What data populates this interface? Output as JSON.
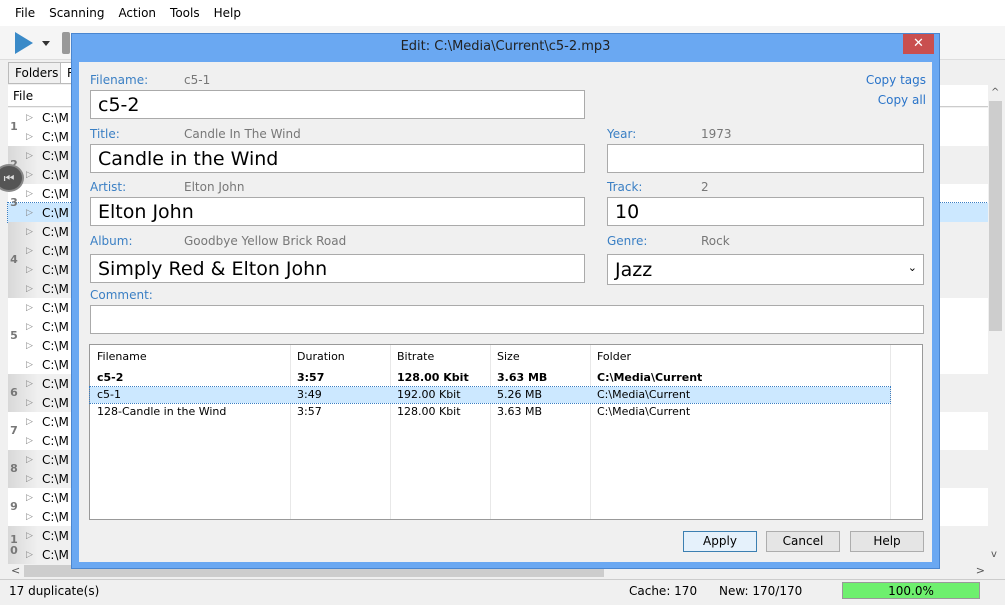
{
  "menu": [
    "File",
    "Scanning",
    "Action",
    "Tools",
    "Help"
  ],
  "tabs": [
    "Folders",
    "R"
  ],
  "list": {
    "header": "File",
    "row_text": "C:\\M",
    "groups": [
      {
        "n": "1",
        "rows": 2
      },
      {
        "n": "2",
        "rows": 2
      },
      {
        "n": "3",
        "rows": 2
      },
      {
        "n": "4",
        "rows": 4
      },
      {
        "n": "5",
        "rows": 4
      },
      {
        "n": "6",
        "rows": 2
      },
      {
        "n": "7",
        "rows": 2
      },
      {
        "n": "8",
        "rows": 2
      },
      {
        "n": "9",
        "rows": 2
      },
      {
        "n": "10",
        "rows": 2
      }
    ],
    "selected_row": 5
  },
  "status": {
    "duplicates": "17 duplicate(s)",
    "cache": "Cache: 170",
    "new": "New: 170/170",
    "progress_label": "100.0%",
    "progress": 100
  },
  "dialog": {
    "title": "Edit: C:\\Media\\Current\\c5-2.mp3",
    "copy_tags": "Copy tags",
    "copy_all": "Copy all",
    "filename": {
      "label": "Filename:",
      "orig": "c5-1",
      "value": "c5-2"
    },
    "title_f": {
      "label": "Title:",
      "orig": "Candle In The Wind",
      "value": "Candle in the Wind"
    },
    "artist": {
      "label": "Artist:",
      "orig": "Elton John",
      "value": "Elton John"
    },
    "album": {
      "label": "Album:",
      "orig": "Goodbye Yellow Brick Road",
      "value": "Simply Red & Elton John"
    },
    "year": {
      "label": "Year:",
      "orig": "1973",
      "value": ""
    },
    "track": {
      "label": "Track:",
      "orig": "2",
      "value": "10"
    },
    "genre": {
      "label": "Genre:",
      "orig": "Rock",
      "value": "Jazz"
    },
    "comment": {
      "label": "Comment:",
      "value": ""
    },
    "grid": {
      "columns": [
        "Filename",
        "Duration",
        "Bitrate",
        "Size",
        "Folder"
      ],
      "rows": [
        [
          "c5-2",
          "3:57",
          "128.00 Kbit",
          "3.63 MB",
          "C:\\Media\\Current"
        ],
        [
          "c5-1",
          "3:49",
          "192.00 Kbit",
          "5.26 MB",
          "C:\\Media\\Current"
        ],
        [
          "128-Candle in the Wind",
          "3:57",
          "128.00 Kbit",
          "3.63 MB",
          "C:\\Media\\Current"
        ]
      ]
    },
    "apply": "Apply",
    "cancel": "Cancel",
    "help": "Help"
  },
  "colors": {
    "accent": "#3a7fc4",
    "titlebar": "#6aa8f2",
    "close": "#c94f4f",
    "progress": "#6ef06e"
  }
}
